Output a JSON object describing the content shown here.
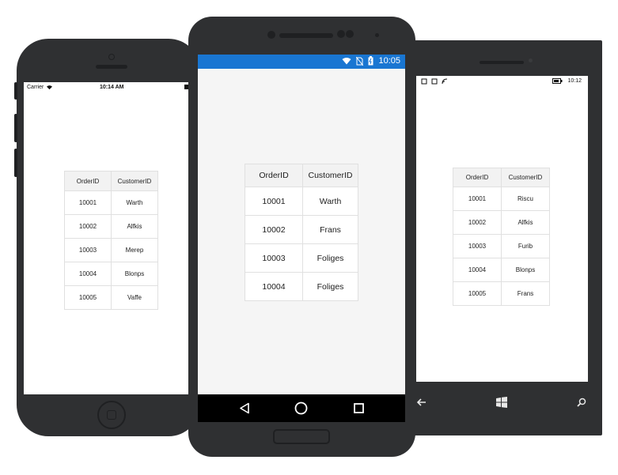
{
  "ios": {
    "status": {
      "carrier": "Carrier",
      "time": "10:14 AM"
    },
    "grid": {
      "headers": [
        "OrderID",
        "CustomerID"
      ],
      "rows": [
        [
          "10001",
          "Warth"
        ],
        [
          "10002",
          "Alfkis"
        ],
        [
          "10003",
          "Merep"
        ],
        [
          "10004",
          "Blonps"
        ],
        [
          "10005",
          "Vaffe"
        ]
      ]
    }
  },
  "android": {
    "status": {
      "time": "10:05"
    },
    "grid": {
      "headers": [
        "OrderID",
        "CustomerID"
      ],
      "rows": [
        [
          "10001",
          "Warth"
        ],
        [
          "10002",
          "Frans"
        ],
        [
          "10003",
          "Foliges"
        ],
        [
          "10004",
          "Foliges"
        ]
      ]
    },
    "colors": {
      "status_bar": "#1976d2",
      "nav_bar": "#000000"
    }
  },
  "windows": {
    "status": {
      "time": "10:12"
    },
    "grid": {
      "headers": [
        "OrderID",
        "CustomerID"
      ],
      "rows": [
        [
          "10001",
          "Riscu"
        ],
        [
          "10002",
          "Alfkis"
        ],
        [
          "10003",
          "Furib"
        ],
        [
          "10004",
          "Blonps"
        ],
        [
          "10005",
          "Frans"
        ]
      ]
    }
  }
}
